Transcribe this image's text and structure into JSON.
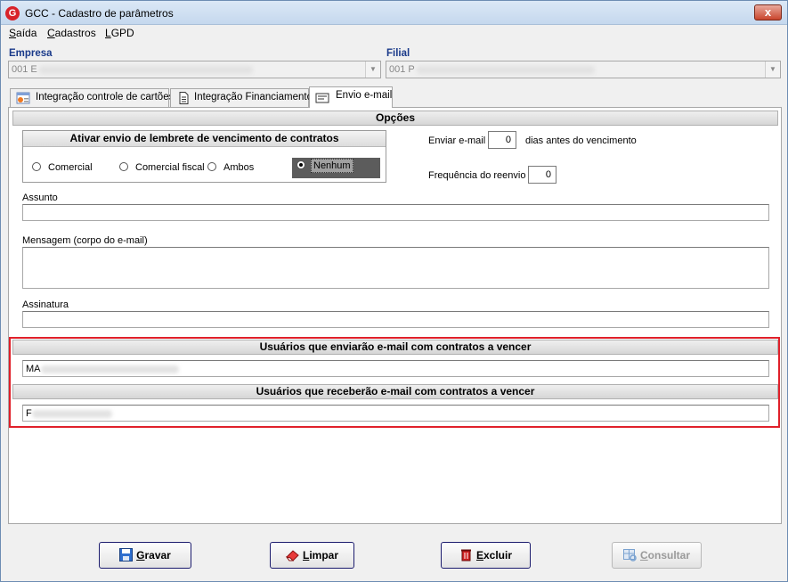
{
  "window": {
    "title": "GCC - Cadastro de parâmetros",
    "icon": "gcc-logo-icon",
    "close": "x"
  },
  "menu": [
    {
      "label": "Saída",
      "mnemonic": "S",
      "rest": "aída"
    },
    {
      "label": "Cadastros",
      "mnemonic": "C",
      "rest": "adastros"
    },
    {
      "label": "LGPD",
      "mnemonic": "L",
      "rest": "GPD"
    }
  ],
  "empresa": {
    "label": "Empresa",
    "value": "001 E"
  },
  "filial": {
    "label": "Filial",
    "value": "001 P"
  },
  "tabs": [
    {
      "label": "Integração controle de cartões",
      "icon": "card-control-icon",
      "active": false
    },
    {
      "label": "Integração Financiamento",
      "icon": "document-icon",
      "active": false
    },
    {
      "label": "Envio e-mail",
      "icon": "envelope-icon",
      "active": true
    }
  ],
  "opcoes": {
    "header": "Opções",
    "group_title": "Ativar envio de lembrete de vencimento de contratos",
    "radios": [
      "Comercial",
      "Comercial fiscal",
      "Ambos",
      "Nenhum"
    ],
    "selected": "Nenhum",
    "enviar_label": "Enviar e-mail",
    "enviar_value": "0",
    "dias_label": "dias antes do vencimento",
    "frequencia_label": "Frequência do reenvio",
    "frequencia_value": "0"
  },
  "fields": {
    "assunto_label": "Assunto",
    "assunto_value": "",
    "mensagem_label": "Mensagem (corpo do e-mail)",
    "mensagem_value": "",
    "assinatura_label": "Assinatura",
    "assinatura_value": ""
  },
  "users": {
    "senders_header": "Usuários que enviarão e-mail com contratos a vencer",
    "senders_value": "MA",
    "receivers_header": "Usuários que receberão e-mail com contratos a vencer",
    "receivers_value": "F"
  },
  "buttons": {
    "gravar": {
      "mnemonic": "G",
      "rest": "ravar",
      "icon": "save-icon"
    },
    "limpar": {
      "mnemonic": "L",
      "rest": "impar",
      "icon": "eraser-icon"
    },
    "excluir": {
      "mnemonic": "E",
      "rest": "xcluir",
      "icon": "trash-icon"
    },
    "consultar": {
      "mnemonic": "C",
      "rest": "onsultar",
      "icon": "search-grid-icon",
      "enabled": false
    }
  },
  "colors": {
    "highlight_border": "#e0202a",
    "label_blue": "#1a3a8a"
  }
}
